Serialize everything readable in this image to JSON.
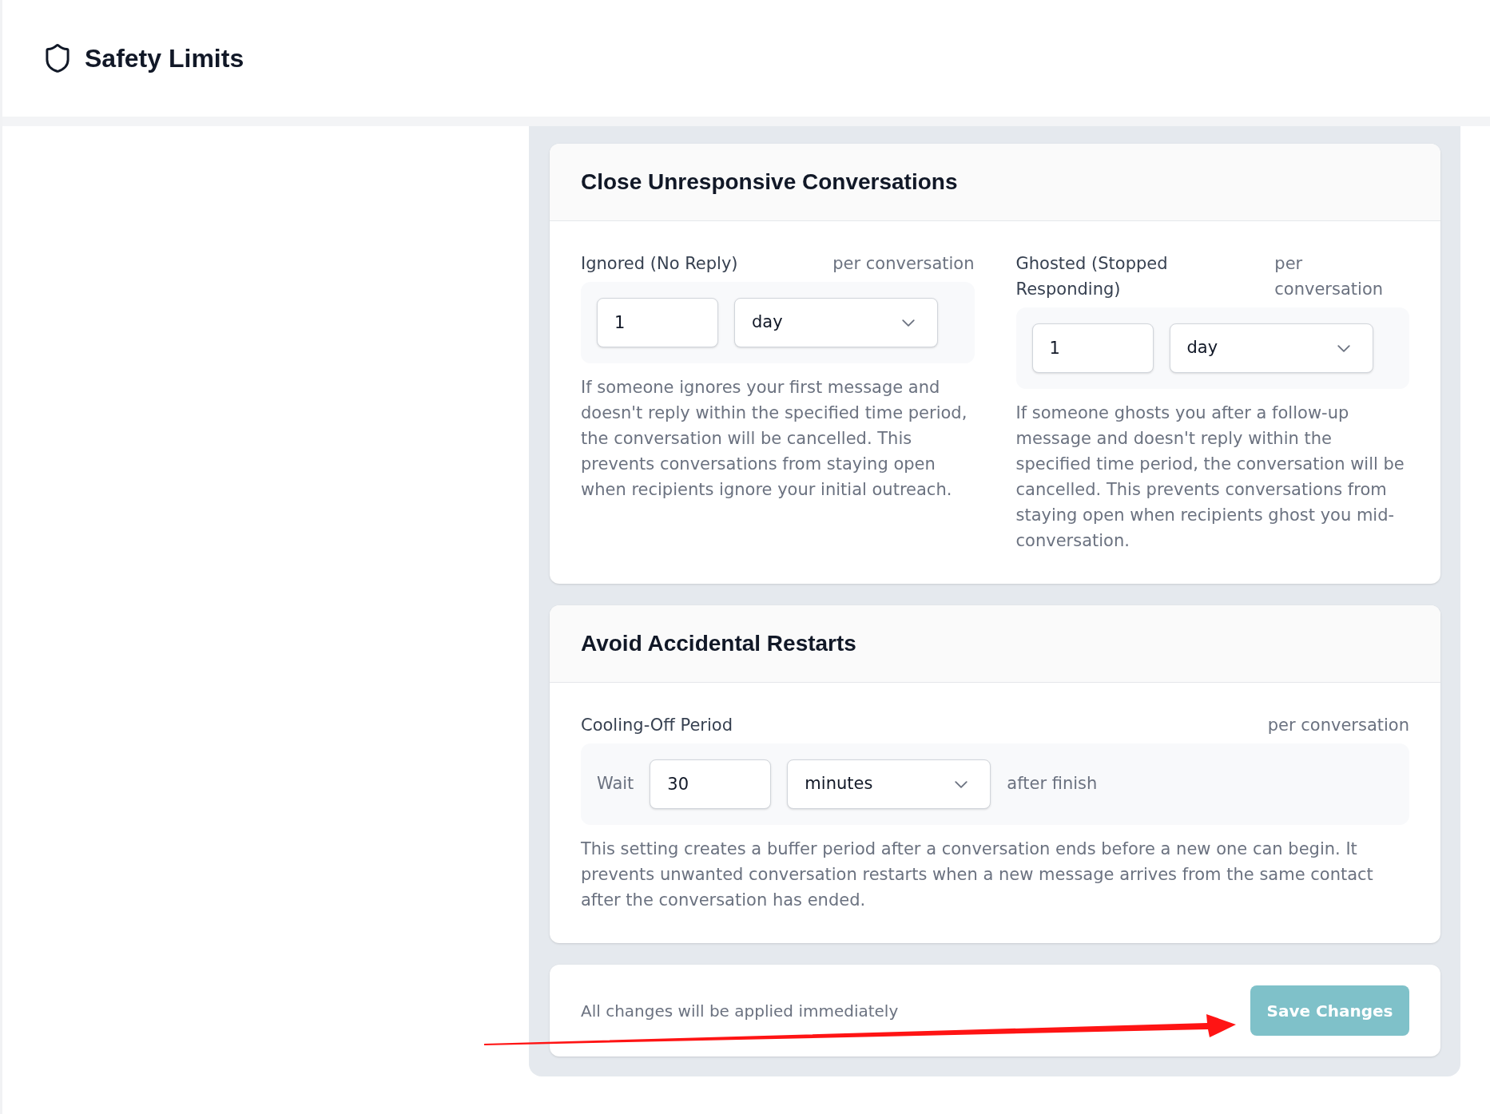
{
  "header": {
    "title": "Safety Limits"
  },
  "sections": [
    {
      "title": "Close Unresponsive Conversations",
      "settings": [
        {
          "label": "Ignored (No Reply)",
          "scope": "per conversation",
          "amount": "1",
          "unit": "day",
          "description": "If someone ignores your first message and doesn't reply within the specified time period, the conversation will be cancelled. This prevents conversations from staying open when recipients ignore your initial outreach."
        },
        {
          "label": "Ghosted (Stopped Responding)",
          "scope": "per conversation",
          "amount": "1",
          "unit": "day",
          "description": "If someone ghosts you after a follow-up message and doesn't reply within the specified time period, the conversation will be cancelled. This prevents conversations from staying open when recipients ghost you mid-conversation."
        }
      ]
    },
    {
      "title": "Avoid Accidental Restarts",
      "settings": [
        {
          "label": "Cooling-Off Period",
          "scope": "per conversation",
          "prefix": "Wait",
          "amount": "30",
          "unit": "minutes",
          "suffix": "after finish",
          "description": "This setting creates a buffer period after a conversation ends before a new one can begin. It prevents unwanted conversation restarts when a new message arrives from the same contact after the conversation has ended."
        }
      ]
    }
  ],
  "footer": {
    "note": "All changes will be applied immediately",
    "save_button": {
      "label": "Save Changes",
      "disabled": true
    }
  },
  "annotation": {
    "kind": "arrow"
  }
}
